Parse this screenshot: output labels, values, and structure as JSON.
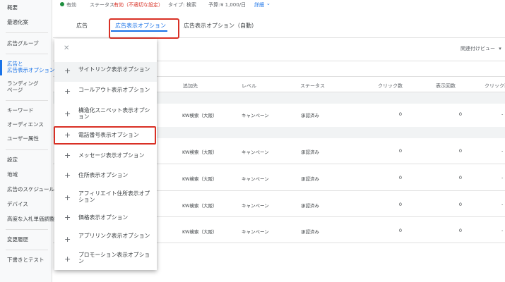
{
  "sidebar": {
    "items": [
      {
        "label": "概要"
      },
      {
        "label": "最適化案"
      },
      {
        "label": "広告グループ"
      },
      {
        "label": "広告と"
      },
      {
        "label": "広告表示オプション"
      },
      {
        "label": "ランディング"
      },
      {
        "label": "ページ"
      },
      {
        "label": "キーワード"
      },
      {
        "label": "オーディエンス"
      },
      {
        "label": "ユーザー属性"
      },
      {
        "label": "設定"
      },
      {
        "label": "地域"
      },
      {
        "label": "広告のスケジュール"
      },
      {
        "label": "デバイス"
      },
      {
        "label": "高度な入札単価調整"
      },
      {
        "label": "変更履歴"
      },
      {
        "label": "下書きとテスト"
      }
    ]
  },
  "status_bar": {
    "status_value": "有効",
    "status_label": "ステータス:",
    "status_detail": "有効（不適切な設定）",
    "type_label": "タイプ:",
    "type_value": "検索",
    "budget_label": "予算:",
    "budget_value": "¥ 1,000/日",
    "details_link": "詳細"
  },
  "tabs": [
    {
      "label": "広告"
    },
    {
      "label": "広告表示オプション"
    },
    {
      "label": "広告表示オプション（自動）"
    }
  ],
  "view_selector": "関連付けビュー",
  "table": {
    "headers": [
      "追加先",
      "レベル",
      "ステータス",
      "クリック数",
      "表示回数",
      "クリック率"
    ],
    "rows": [
      {
        "added_to": "KW検索（大阪）",
        "level": "キャンペーン",
        "status": "承認済み",
        "clicks": "0",
        "impressions": "0",
        "ctr": "-"
      },
      {
        "added_to": "KW検索（大阪）",
        "level": "キャンペーン",
        "status": "承認済み",
        "clicks": "0",
        "impressions": "0",
        "ctr": "-"
      },
      {
        "added_to": "KW検索（大阪）",
        "level": "キャンペーン",
        "status": "承認済み",
        "clicks": "0",
        "impressions": "0",
        "ctr": "-"
      },
      {
        "added_to": "KW検索（大阪）",
        "level": "キャンペーン",
        "status": "承認済み",
        "clicks": "0",
        "impressions": "0",
        "ctr": "-"
      },
      {
        "added_to": "KW検索（大阪）",
        "level": "キャンペーン",
        "status": "承認済み",
        "clicks": "0",
        "impressions": "0",
        "ctr": "-"
      }
    ]
  },
  "menu": {
    "close_icon": "close-icon",
    "items": [
      {
        "label": "サイトリンク表示オプション"
      },
      {
        "label": "コールアウト表示オプション"
      },
      {
        "label": "構造化スニペット表示オプション"
      },
      {
        "label": "電話番号表示オプション"
      },
      {
        "label": "メッセージ表示オプション"
      },
      {
        "label": "住所表示オプション"
      },
      {
        "label": "アフィリエイト住所表示オプション"
      },
      {
        "label": "価格表示オプション"
      },
      {
        "label": "アプリリンク表示オプション"
      },
      {
        "label": "プロモーション表示オプション"
      }
    ]
  },
  "colors": {
    "accent": "#1a73e8",
    "highlight_box": "#d93025",
    "status_ok": "#1e8e3e"
  }
}
